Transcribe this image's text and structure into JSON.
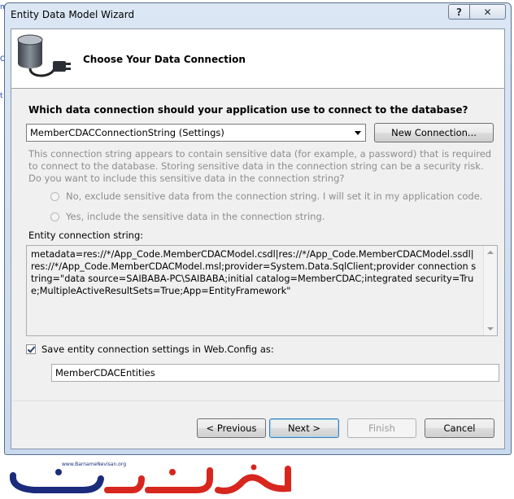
{
  "window": {
    "title": "Entity Data Model Wizard",
    "help_symbol": "?",
    "close_symbol": "✕"
  },
  "header": {
    "title": "Choose Your Data Connection",
    "icon": "database-plug-icon"
  },
  "question": "Which data connection should your application use to connect to the database?",
  "connection_select": {
    "value": "MemberCDACConnectionString (Settings)"
  },
  "new_connection_label": "New Connection...",
  "sensitive_note": "This connection string appears to contain sensitive data (for example, a password) that is required to connect to the database. Storing sensitive data in the connection string can be a security risk. Do you want to include this sensitive data in the connection string?",
  "radio_exclude_label": "No, exclude sensitive data from the connection string. I will set it in my application code.",
  "radio_include_label": "Yes, include the sensitive data in the connection string.",
  "entity_connection_label": "Entity connection string:",
  "entity_connection_string": "metadata=res://*/App_Code.MemberCDACModel.csdl|res://*/App_Code.MemberCDACModel.ssdl|res://*/App_Code.MemberCDACModel.msl;provider=System.Data.SqlClient;provider connection string=\"data source=SAIBABA-PC\\SAIBABA;initial catalog=MemberCDAC;integrated security=True;MultipleActiveResultSets=True;App=EntityFramework\"",
  "save_settings": {
    "checked": true,
    "label": "Save entity connection settings in Web.Config as:",
    "value": "MemberCDACEntities"
  },
  "buttons": {
    "previous": "< Previous",
    "next": "Next >",
    "finish": "Finish",
    "cancel": "Cancel"
  },
  "watermark": {
    "url": "www.BarnameNevisan.org",
    "text": "برنامه نویسان"
  },
  "colors": {
    "accent": "#3c7fb1",
    "title_bar": "#dbe7f4",
    "watermark_red": "#d7261e",
    "watermark_blue": "#1b2c7c"
  }
}
